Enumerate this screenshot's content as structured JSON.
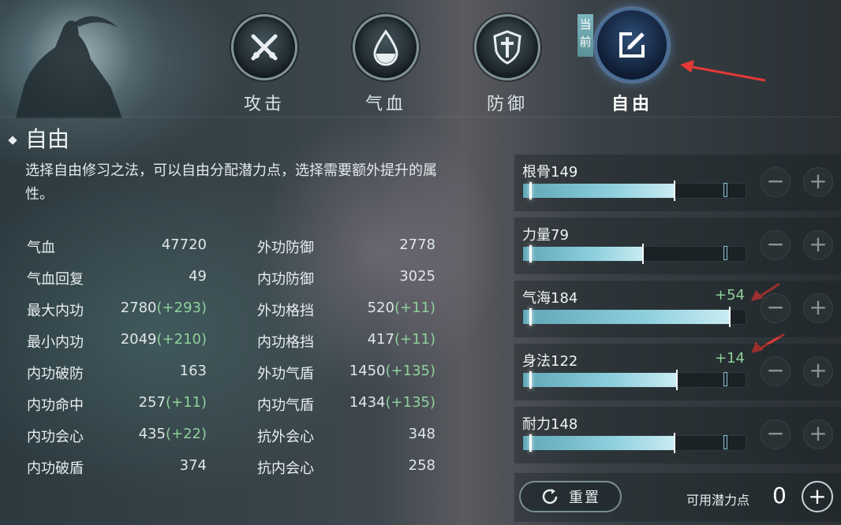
{
  "tabs": [
    {
      "label": "攻击",
      "icon": "crossed-swords-icon"
    },
    {
      "label": "气血",
      "icon": "blood-drop-icon"
    },
    {
      "label": "防御",
      "icon": "shield-icon"
    },
    {
      "label": "自由",
      "icon": "edit-icon"
    }
  ],
  "current_badge": "当前",
  "section": {
    "title": "自由",
    "description": "选择自由修习之法，可以自由分配潜力点，选择需要额外提升的属性。"
  },
  "stats_left": [
    {
      "name": "气血",
      "value": "47720",
      "bonus": ""
    },
    {
      "name": "气血回复",
      "value": "49",
      "bonus": ""
    },
    {
      "name": "最大内功",
      "value": "2780",
      "bonus": "(+293)"
    },
    {
      "name": "最小内功",
      "value": "2049",
      "bonus": "(+210)"
    },
    {
      "name": "内功破防",
      "value": "163",
      "bonus": ""
    },
    {
      "name": "内功命中",
      "value": "257",
      "bonus": "(+11)"
    },
    {
      "name": "内功会心",
      "value": "435",
      "bonus": "(+22)"
    },
    {
      "name": "内功破盾",
      "value": "374",
      "bonus": ""
    }
  ],
  "stats_right": [
    {
      "name": "外功防御",
      "value": "2778",
      "bonus": ""
    },
    {
      "name": "内功防御",
      "value": "3025",
      "bonus": ""
    },
    {
      "name": "外功格挡",
      "value": "520",
      "bonus": "(+11)"
    },
    {
      "name": "内功格挡",
      "value": "417",
      "bonus": "(+11)"
    },
    {
      "name": "外功气盾",
      "value": "1450",
      "bonus": "(+135)"
    },
    {
      "name": "内功气盾",
      "value": "1434",
      "bonus": "(+135)"
    },
    {
      "name": "抗外会心",
      "value": "348",
      "bonus": ""
    },
    {
      "name": "抗内会心",
      "value": "258",
      "bonus": ""
    }
  ],
  "attributes": [
    {
      "label": "根骨149",
      "bonus": "",
      "fill": 0.68
    },
    {
      "label": "力量79",
      "bonus": "",
      "fill": 0.54
    },
    {
      "label": "气海184",
      "bonus": "+54",
      "fill": 0.93
    },
    {
      "label": "身法122",
      "bonus": "+14",
      "fill": 0.69
    },
    {
      "label": "耐力148",
      "bonus": "",
      "fill": 0.68
    }
  ],
  "minus_glyph": "−",
  "plus_glyph": "+",
  "reset_label": "重置",
  "available_points_label": "可用潜力点",
  "available_points_value": "0",
  "colors": {
    "accent": "#5fa7b8",
    "bonus_green": "#8fd19a",
    "arrow_red": "#e53935"
  }
}
